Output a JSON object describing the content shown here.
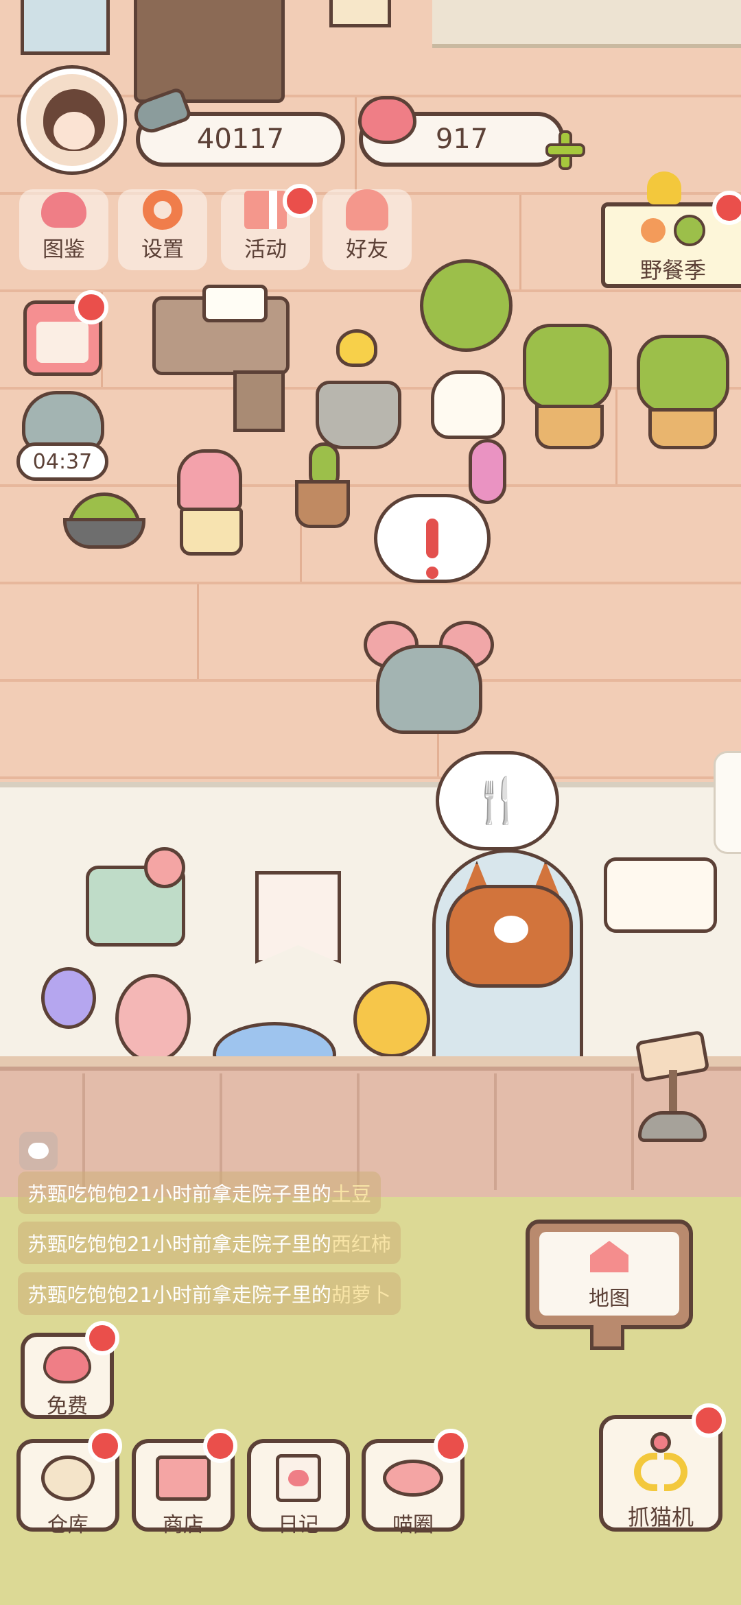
{
  "hud": {
    "fish_icon": "fish-icon",
    "coins": "40117",
    "heart_icon": "heart-face-icon",
    "hearts": "917",
    "add_icon": "plus-icon"
  },
  "menu": [
    {
      "label": "图鉴",
      "icon": "cat-book-icon",
      "badge": false
    },
    {
      "label": "设置",
      "icon": "gear-icon",
      "badge": false
    },
    {
      "label": "活动",
      "icon": "gift-icon",
      "badge": true
    },
    {
      "label": "好友",
      "icon": "friends-icon",
      "badge": false
    }
  ],
  "event": {
    "label": "野餐季",
    "icon": "picnic-flag-icon"
  },
  "timer": {
    "value": "04:37"
  },
  "feed": [
    {
      "prefix": "苏甄吃饱饱21小时前拿走院子里的",
      "item": "土豆"
    },
    {
      "prefix": "苏甄吃饱饱21小时前拿走院子里的",
      "item": "西红柿"
    },
    {
      "prefix": "苏甄吃饱饱21小时前拿走院子里的",
      "item": "胡萝卜"
    }
  ],
  "map_sign": {
    "label": "地图",
    "icon": "house-icon"
  },
  "free": {
    "label": "免费",
    "icon": "heart-icon"
  },
  "bottom_nav": [
    {
      "label": "仓库",
      "icon": "storage-icon"
    },
    {
      "label": "商店",
      "icon": "shop-icon"
    },
    {
      "label": "日记",
      "icon": "diary-icon"
    },
    {
      "label": "喵圈",
      "icon": "cat-planet-icon"
    }
  ],
  "claw": {
    "label": "抓猫机",
    "icon": "claw-icon"
  },
  "colors": {
    "outline": "#5c4137",
    "badge": "#ea4f4b",
    "floor": "#f2cdb6",
    "grass": "#dcd995",
    "leaf": "#9cbf4a"
  }
}
